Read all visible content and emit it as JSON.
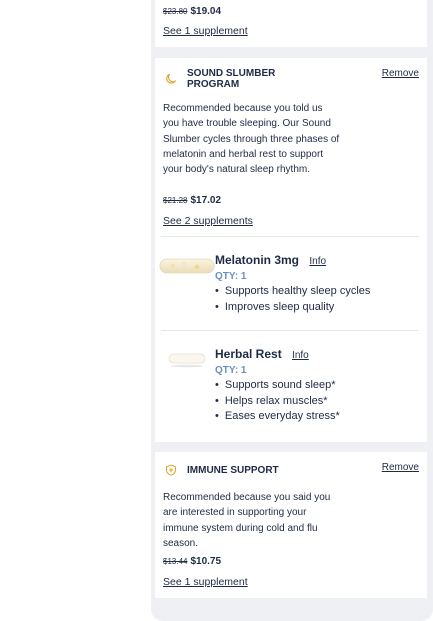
{
  "top_card": {
    "price_old": "$23.80",
    "price_new": "$19.04",
    "see_link": "See 1 supplement"
  },
  "sleep_program": {
    "icon": "moon-icon",
    "title": "SOUND SLUMBER PROGRAM",
    "remove": "Remove",
    "description": "Recommended because you told us you have trouble sleeping. Our Sound Slumber cycles through three phases of melatonin and herbal rest to support your body's natural sleep rhythm.",
    "price_old": "$21.28",
    "price_new": "$17.02",
    "see_link": "See 2 supplements",
    "supplements": [
      {
        "name": "Melatonin 3mg",
        "info": "Info",
        "qty": "QTY: 1",
        "benefits": [
          "Supports healthy sleep cycles",
          "Improves sleep quality"
        ]
      },
      {
        "name": "Herbal Rest",
        "info": "Info",
        "qty": "QTY: 1",
        "benefits": [
          "Supports sound sleep*",
          "Helps relax muscles*",
          "Eases everyday stress*"
        ]
      }
    ]
  },
  "immune_program": {
    "icon": "shield-plus-icon",
    "title": "IMMUNE SUPPORT",
    "remove": "Remove",
    "description": "Recommended because you said you are interested in supporting your immune system during cold and flu season.",
    "price_old": "$13.44",
    "price_new": "$10.75",
    "see_link": "See 1 supplement"
  },
  "colors": {
    "accent": "#e0a32e",
    "text": "#1f2a44",
    "qty": "#6a8fc4",
    "panel_bg": "#eef0f3"
  }
}
